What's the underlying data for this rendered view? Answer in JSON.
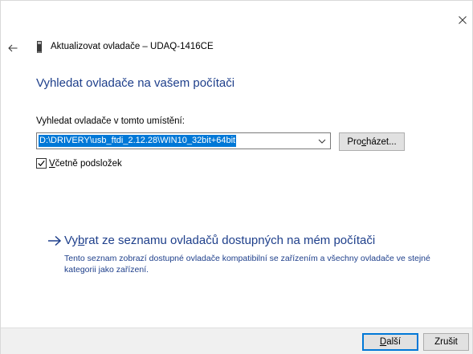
{
  "window": {
    "title": "Aktualizovat ovladače – UDAQ-1416CE"
  },
  "page": {
    "heading": "Vyhledat ovladače na vašem počítači",
    "location_label": "Vyhledat ovladače v tomto umístění:",
    "path_value": "D:\\DRIVERY\\usb_ftdi_2.12.28\\WIN10_32bit+64bit",
    "browse": {
      "before": "Pro",
      "accel": "c",
      "after": "házet..."
    },
    "include_subfolders": {
      "accel": "V",
      "after": "četně podsložek",
      "checked": true
    },
    "pick_link": {
      "before": "Vy",
      "accel": "b",
      "after": "rat ze seznamu ovladačů dostupných na mém počítači"
    },
    "pick_description": "Tento seznam zobrazí dostupné ovladače kompatibilní se zařízením a všechny ovladače ve stejné kategorii jako zařízení."
  },
  "footer": {
    "next": {
      "accel": "D",
      "after": "alší"
    },
    "cancel": "Zrušit"
  },
  "colors": {
    "heading": "#1e3f8b",
    "selection": "#0078d7",
    "footer_bg": "#f0f0f0"
  },
  "icons": {
    "close": "close-icon",
    "back": "back-arrow-icon",
    "device": "usb-device-icon",
    "dropdown": "chevron-down-icon",
    "check": "checkmark-icon",
    "link": "right-arrow-icon"
  }
}
